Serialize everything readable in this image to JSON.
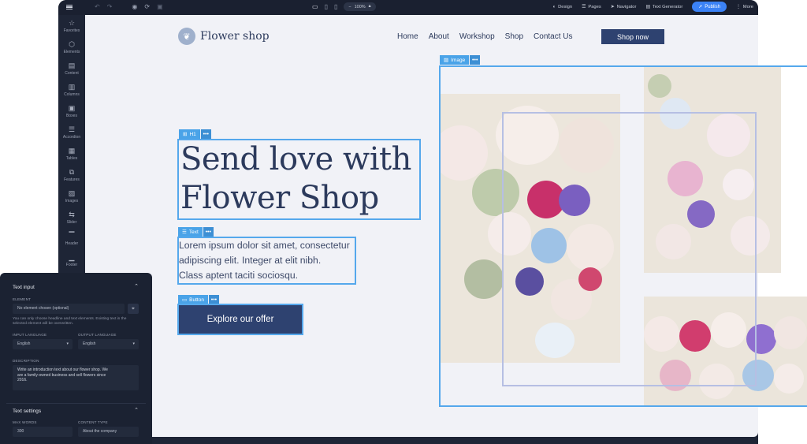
{
  "toolbar": {
    "zoom": "100%",
    "items": [
      {
        "icon": "palette-icon",
        "label": "Design"
      },
      {
        "icon": "pages-icon",
        "label": "Pages"
      },
      {
        "icon": "navigator-icon",
        "label": "Navigator"
      },
      {
        "icon": "text-generator-icon",
        "label": "Text Generator"
      }
    ],
    "publish_label": "Publish",
    "more_label": "More"
  },
  "sidebar": {
    "items": [
      {
        "icon": "star-icon",
        "glyph": "☆",
        "label": "Favorites"
      },
      {
        "icon": "cube-icon",
        "glyph": "⬡",
        "label": "Elements"
      },
      {
        "icon": "document-icon",
        "glyph": "▤",
        "label": "Content"
      },
      {
        "icon": "columns-icon",
        "glyph": "▥",
        "label": "Columns"
      },
      {
        "icon": "boxes-icon",
        "glyph": "▣",
        "label": "Boxes"
      },
      {
        "icon": "accordion-icon",
        "glyph": "☰",
        "label": "Accordion"
      },
      {
        "icon": "table-icon",
        "glyph": "▦",
        "label": "Tables"
      },
      {
        "icon": "features-icon",
        "glyph": "⧉",
        "label": "Features"
      },
      {
        "icon": "image-icon",
        "glyph": "▨",
        "label": "Images"
      },
      {
        "icon": "slider-icon",
        "glyph": "⇆",
        "label": "Slider"
      },
      {
        "icon": "header-icon",
        "glyph": "▔",
        "label": "Header"
      },
      {
        "icon": "footer-icon",
        "glyph": "▁",
        "label": "Footer"
      }
    ]
  },
  "site": {
    "logo_text": "Flower shop",
    "nav": [
      "Home",
      "About",
      "Workshop",
      "Shop",
      "Contact Us"
    ],
    "shop_now": "Shop now",
    "heading_line1": "Send love with",
    "heading_line2": "Flower Shop",
    "paragraph_line1": "Lorem ipsum dolor sit amet, consectetur",
    "paragraph_line2": "adipiscing elit. Integer at elit nibh.",
    "paragraph_line3": "Class aptent taciti sociosqu.",
    "cta": "Explore our offer"
  },
  "selection_tags": {
    "h1": "H1",
    "text": "Text",
    "button": "Button",
    "image": "Image",
    "more": "•••"
  },
  "panel": {
    "title": "Text input",
    "element_label": "ELEMENT",
    "element_placeholder": "No element chosen (optional)",
    "element_help_line1": "You can only choose headline and text elements. Existing text in the",
    "element_help_line2": "selected element will be overwritten.",
    "input_language_label": "INPUT LANGUAGE",
    "input_language": "English",
    "output_language_label": "OUTPUT LANGUAGE",
    "output_language": "English",
    "description_label": "DESCRIPTION",
    "description_line1": "Write an introduction text about our flower shop. We",
    "description_line2": "are a family-owned business and sell flowers since",
    "description_line3": "2016.",
    "settings_title": "Text settings",
    "max_words_label": "MAX WORDS",
    "max_words": "300",
    "content_type_label": "CONTENT TYPE",
    "content_type": "About the company"
  },
  "colors": {
    "accent": "#3b82f6",
    "brand_navy": "#2e4270",
    "selection": "#55a8ec",
    "canvas_bg": "#f1f2f7",
    "chrome": "#1e2536"
  }
}
